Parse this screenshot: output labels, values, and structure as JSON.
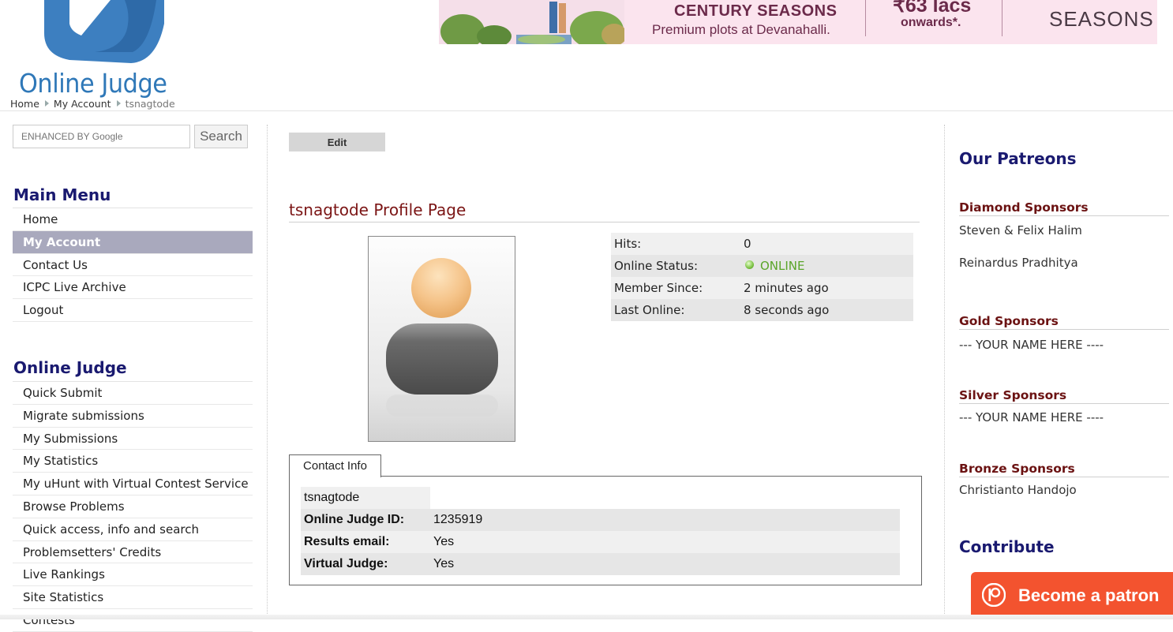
{
  "header": {
    "logo_text": "Online Judge",
    "breadcrumb": [
      "Home",
      "My Account",
      "tsnagtode"
    ]
  },
  "ad": {
    "headline": "CENTURY SEASONS",
    "tagline": "Premium plots at Devanahalli.",
    "price": "₹63 lacs",
    "price_suffix": "onwards*.",
    "brand": "SEASONS"
  },
  "search": {
    "placeholder": "ENHANCED BY Google",
    "button_label": "Search"
  },
  "main_menu": {
    "title": "Main Menu",
    "items": [
      "Home",
      "My Account",
      "Contact Us",
      "ICPC Live Archive",
      "Logout"
    ],
    "active": "My Account"
  },
  "online_judge_menu": {
    "title": "Online Judge",
    "items": [
      "Quick Submit",
      "Migrate submissions",
      "My Submissions",
      "My Statistics",
      "My uHunt with Virtual Contest Service",
      "Browse Problems",
      "Quick access, info and search",
      "Problemsetters' Credits",
      "Live Rankings",
      "Site Statistics",
      "Contests"
    ]
  },
  "profile": {
    "edit_label": "Edit",
    "title": "tsnagtode Profile Page",
    "stats": [
      {
        "label": "Hits:",
        "value": "0"
      },
      {
        "label": "Online Status:",
        "value": "ONLINE"
      },
      {
        "label": "Member Since:",
        "value": "2 minutes ago"
      },
      {
        "label": "Last Online:",
        "value": "8 seconds ago"
      }
    ],
    "status_color": "#5aa52a"
  },
  "contact": {
    "tab_label": "Contact Info",
    "username": "tsnagtode",
    "rows": [
      {
        "label": "Online Judge ID:",
        "value": "1235919"
      },
      {
        "label": "Results email:",
        "value": "Yes"
      },
      {
        "label": "Virtual Judge:",
        "value": "Yes"
      }
    ]
  },
  "sidebar_right": {
    "patreons_title": "Our Patreons",
    "tiers": [
      {
        "name": "Diamond Sponsors",
        "members": [
          "Steven & Felix Halim",
          "Reinardus Pradhitya"
        ]
      },
      {
        "name": "Gold Sponsors",
        "members": [
          "--- YOUR NAME HERE ----"
        ]
      },
      {
        "name": "Silver Sponsors",
        "members": [
          "--- YOUR NAME HERE ----"
        ]
      },
      {
        "name": "Bronze Sponsors",
        "members": [
          "Christianto Handojo"
        ]
      }
    ],
    "contribute_title": "Contribute",
    "patron_button": "Become a patron"
  },
  "colors": {
    "menu_heading": "#1a1a70",
    "section_heading": "#7b1515",
    "active_menu_bg": "#a9a9bd",
    "logo_blue": "#2f78b8",
    "patreon_orange": "#f3532f"
  }
}
